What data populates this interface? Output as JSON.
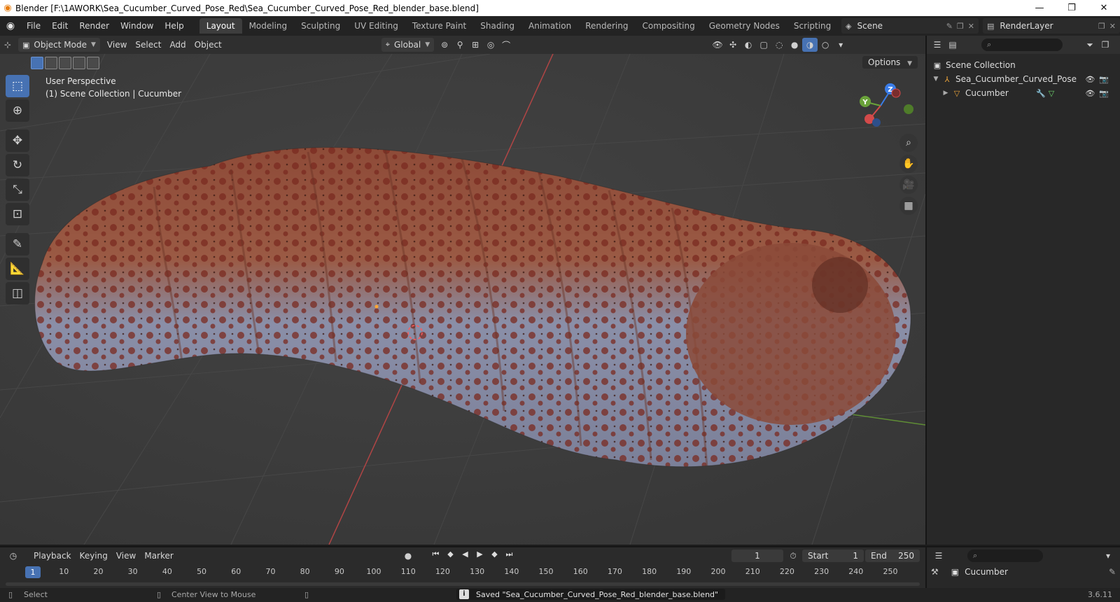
{
  "window": {
    "title": "Blender [F:\\1AWORK\\Sea_Cucumber_Curved_Pose_Red\\Sea_Cucumber_Curved_Pose_Red_blender_base.blend]"
  },
  "menubar": {
    "items": [
      "File",
      "Edit",
      "Render",
      "Window",
      "Help"
    ],
    "workspaces": [
      "Layout",
      "Modeling",
      "Sculpting",
      "UV Editing",
      "Texture Paint",
      "Shading",
      "Animation",
      "Rendering",
      "Compositing",
      "Geometry Nodes",
      "Scripting"
    ],
    "active_workspace": "Layout",
    "scene": "Scene",
    "render_layer": "RenderLayer"
  },
  "viewport": {
    "mode": "Object Mode",
    "menus": [
      "View",
      "Select",
      "Add",
      "Object"
    ],
    "orientation": "Global",
    "perspective_label": "User Perspective",
    "collection_label": "(1) Scene Collection | Cucumber",
    "options_label": "Options",
    "gizmo_axes": {
      "z": "Z",
      "y": "Y"
    }
  },
  "outliner": {
    "root": "Scene Collection",
    "rows": [
      {
        "name": "Sea_Cucumber_Curved_Pose"
      },
      {
        "name": "Cucumber"
      }
    ]
  },
  "properties": {
    "object": "Cucumber"
  },
  "timeline": {
    "menus": [
      "Playback",
      "Keying",
      "View",
      "Marker"
    ],
    "current_frame": "1",
    "start_label": "Start",
    "start_value": "1",
    "end_label": "End",
    "end_value": "250",
    "ticks": [
      "1",
      "10",
      "20",
      "30",
      "40",
      "50",
      "60",
      "70",
      "80",
      "90",
      "100",
      "110",
      "120",
      "130",
      "140",
      "150",
      "160",
      "170",
      "180",
      "190",
      "200",
      "210",
      "220",
      "230",
      "240",
      "250"
    ]
  },
  "statusbar": {
    "select": "Select",
    "center_view": "Center View to Mouse",
    "saved_message": "Saved \"Sea_Cucumber_Curved_Pose_Red_blender_base.blend\"",
    "version": "3.6.11"
  },
  "colors": {
    "accent": "#4772b3",
    "x_axis": "#d34a4a",
    "y_axis": "#6aa23a",
    "z_axis": "#3b7de8"
  }
}
